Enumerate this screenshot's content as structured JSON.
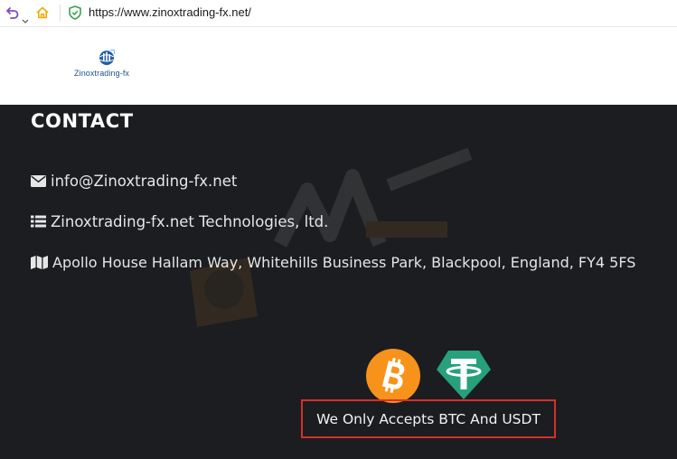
{
  "browser": {
    "url": "https://www.zinoxtrading-fx.net/",
    "icons": [
      "back-icon",
      "chevron-down-icon",
      "home-icon",
      "shield-icon"
    ]
  },
  "header": {
    "logo_text": "Zinoxtrading-fx"
  },
  "contact": {
    "title": "CONTACT",
    "email": "info@Zinoxtrading-fx.net",
    "company": "Zinoxtrading-fx.net Technologies, ltd.",
    "address": "Apollo House Hallam Way, Whitehills Business Park, Blackpool, England, FY4 5FS",
    "icons": [
      "envelope-icon",
      "list-icon",
      "map-icon"
    ]
  },
  "crypto": {
    "notice": "We Only Accepts BTC And USDT",
    "icons": [
      "bitcoin-icon",
      "tether-icon"
    ]
  },
  "colors": {
    "background": "#1b1d20",
    "bitcoin": "#f7931a",
    "tether": "#26a17b",
    "highlight_border": "#d5302b",
    "home_icon": "#f2a900",
    "shield_icon": "#2ea043"
  }
}
